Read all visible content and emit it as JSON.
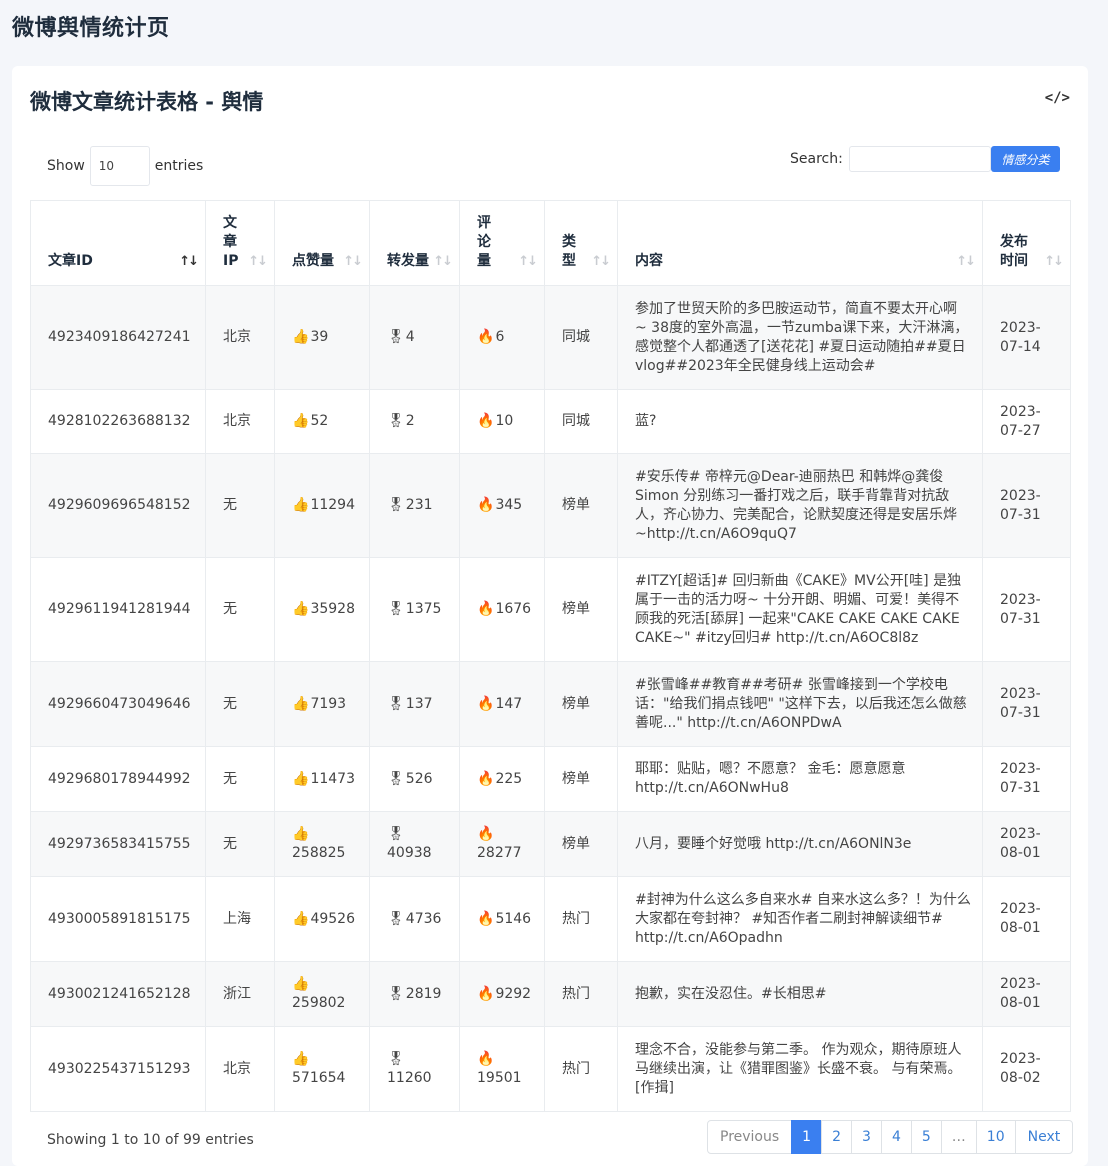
{
  "page_title": "微博舆情统计页",
  "card": {
    "title": "微博文章统计表格 - 舆情",
    "code_icon": "</>"
  },
  "length": {
    "show_label": "Show",
    "value": "10",
    "entries_label": "entries"
  },
  "search": {
    "label": "Search:",
    "value": ""
  },
  "classify_button": "情感分类",
  "columns": [
    "文章ID",
    "文章IP",
    "点赞量",
    "转发量",
    "评论量",
    "类型",
    "内容",
    "发布时间"
  ],
  "icons": {
    "like": "thumbs-up-icon",
    "repost": "medal-icon",
    "comment": "fire-icon"
  },
  "rows": [
    {
      "id": "4923409186427241",
      "ip": "北京",
      "likes": "39",
      "reposts": "4",
      "comments": "6",
      "type": "同城",
      "content": "参加了世贸天阶的多巴胺运动节，简直不要太开心啊 ~ 38度的室外高温，一节zumba课下来，大汗淋漓，感觉整个人都通透了[送花花] #夏日运动随拍##夏日vlog##2023年全民健身线上运动会#",
      "date": "2023-07-14"
    },
    {
      "id": "4928102263688132",
      "ip": "北京",
      "likes": "52",
      "reposts": "2",
      "comments": "10",
      "type": "同城",
      "content": "蓝?",
      "date": "2023-07-27"
    },
    {
      "id": "4929609696548152",
      "ip": "无",
      "likes": "11294",
      "reposts": "231",
      "comments": "345",
      "type": "榜单",
      "content": "#安乐传# 帝梓元@Dear-迪丽热巴 和韩烨@龚俊Simon 分别练习一番打戏之后，联手背靠背对抗敌人，齐心协力、完美配合，论默契度还得是安居乐烨~http://t.cn/A6O9quQ7",
      "date": "2023-07-31"
    },
    {
      "id": "4929611941281944",
      "ip": "无",
      "likes": "35928",
      "reposts": "1375",
      "comments": "1676",
      "type": "榜单",
      "content": "#ITZY[超话]# 回归新曲《CAKE》MV公开[哇] 是独属于一击的活力呀~ 十分开朗、明媚、可爱！美得不顾我的死活[舔屏] 一起来\"CAKE CAKE CAKE CAKE CAKE~\" #itzy回归# http://t.cn/A6OC8l8z",
      "date": "2023-07-31"
    },
    {
      "id": "4929660473049646",
      "ip": "无",
      "likes": "7193",
      "reposts": "137",
      "comments": "147",
      "type": "榜单",
      "content": "#张雪峰##教育##考研# 张雪峰接到一个学校电话：\"给我们捐点钱吧\" \"这样下去，以后我还怎么做慈善呢...\" http://t.cn/A6ONPDwA",
      "date": "2023-07-31"
    },
    {
      "id": "4929680178944992",
      "ip": "无",
      "likes": "11473",
      "reposts": "526",
      "comments": "225",
      "type": "榜单",
      "content": "耶耶：贴贴，嗯？不愿意？ 金毛：愿意愿意 http://t.cn/A6ONwHu8",
      "date": "2023-07-31"
    },
    {
      "id": "4929736583415755",
      "ip": "无",
      "likes": "258825",
      "reposts": "40938",
      "comments": "28277",
      "type": "榜单",
      "content": "八月，要睡个好觉哦 http://t.cn/A6ONlN3e",
      "date": "2023-08-01"
    },
    {
      "id": "4930005891815175",
      "ip": "上海",
      "likes": "49526",
      "reposts": "4736",
      "comments": "5146",
      "type": "热门",
      "content": "#封神为什么这么多自来水# 自来水这么多？！为什么大家都在夸封神？ #知否作者二刷封神解读细节# http://t.cn/A6Opadhn",
      "date": "2023-08-01"
    },
    {
      "id": "4930021241652128",
      "ip": "浙江",
      "likes": "259802",
      "reposts": "2819",
      "comments": "9292",
      "type": "热门",
      "content": "抱歉，实在没忍住。#长相思#",
      "date": "2023-08-01"
    },
    {
      "id": "4930225437151293",
      "ip": "北京",
      "likes": "571654",
      "reposts": "11260",
      "comments": "19501",
      "type": "热门",
      "content": "理念不合，没能参与第二季。 作为观众，期待原班人马继续出演，让《猎罪图鉴》长盛不衰。 与有荣焉。 [作揖]",
      "date": "2023-08-02"
    }
  ],
  "info": "Showing 1 to 10 of 99 entries",
  "pagination": {
    "previous": "Previous",
    "pages": [
      "1",
      "2",
      "3",
      "4",
      "5"
    ],
    "ellipsis": "…",
    "last": "10",
    "next": "Next"
  }
}
